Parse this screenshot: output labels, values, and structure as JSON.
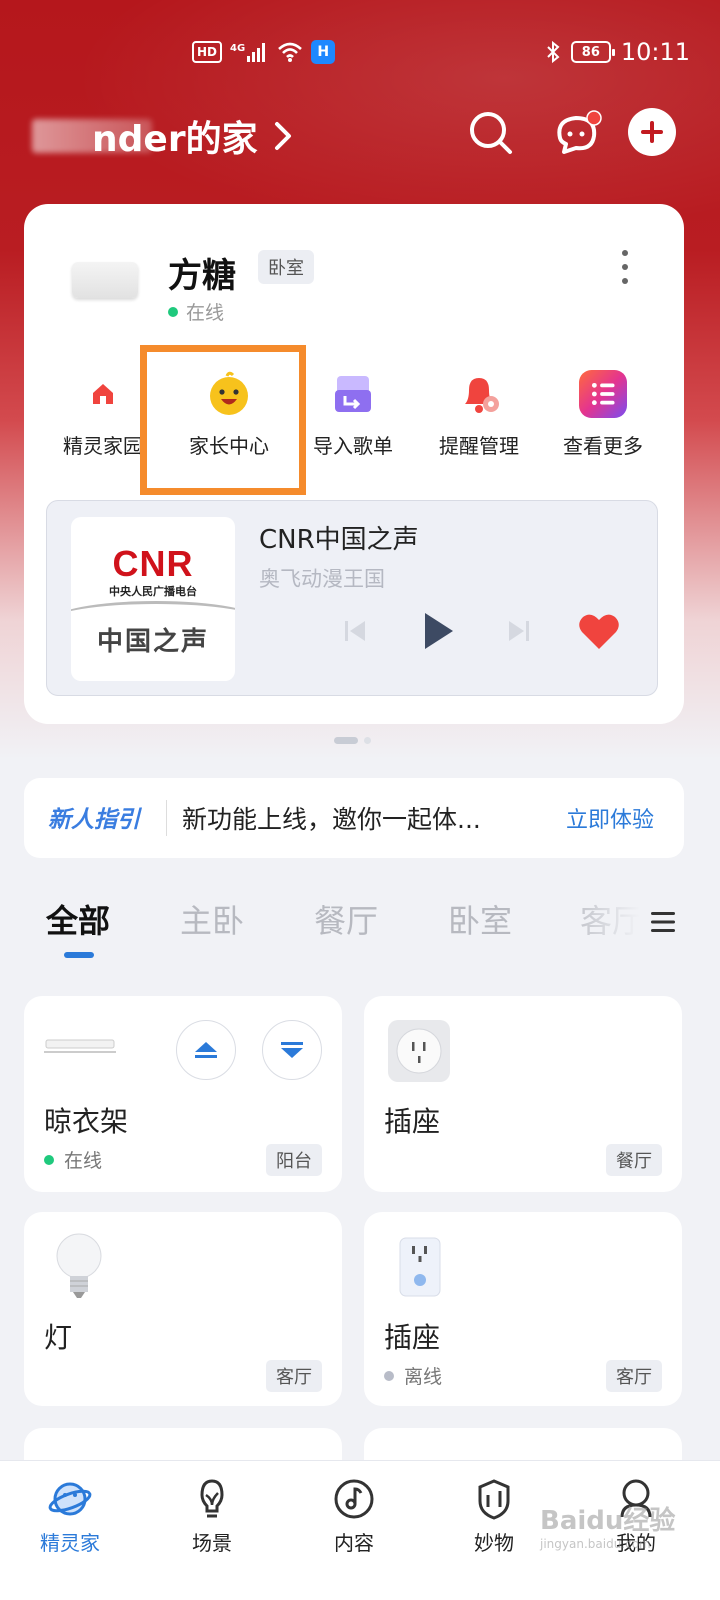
{
  "status_bar": {
    "hd": "HD",
    "network": "4G",
    "battery": "86",
    "time": "10:11"
  },
  "header": {
    "home_title": "nder的家"
  },
  "device_card": {
    "device_name": "方糖",
    "room": "卧室",
    "status": "在线",
    "shortcuts": [
      {
        "label": "精灵家园",
        "icon": "house-icon"
      },
      {
        "label": "家长中心",
        "icon": "kid-face-icon"
      },
      {
        "label": "导入歌单",
        "icon": "import-playlist-icon"
      },
      {
        "label": "提醒管理",
        "icon": "bell-icon"
      },
      {
        "label": "查看更多",
        "icon": "list-more-icon"
      }
    ],
    "player": {
      "cover_brand": "CNR",
      "cover_subtitle": "中央人民广播电台",
      "cover_lower": "中国之声",
      "title": "CNR中国之声",
      "subtitle": "奥飞动漫王国"
    }
  },
  "banner": {
    "tag": "新人指引",
    "message": "新功能上线，邀你一起体...",
    "cta": "立即体验"
  },
  "room_tabs": [
    "全部",
    "主卧",
    "餐厅",
    "卧室",
    "客厅"
  ],
  "device_tiles": [
    {
      "name": "晾衣架",
      "status": "在线",
      "room": "阳台",
      "icon": "clothes-rack-icon"
    },
    {
      "name": "插座",
      "status": "",
      "room": "餐厅",
      "icon": "socket-icon"
    },
    {
      "name": "灯",
      "status": "",
      "room": "客厅",
      "icon": "bulb-icon"
    },
    {
      "name": "插座",
      "status": "离线",
      "room": "客厅",
      "icon": "wall-socket-icon"
    }
  ],
  "bottom_nav": [
    {
      "label": "精灵家",
      "icon": "planet-icon",
      "active": true
    },
    {
      "label": "场景",
      "icon": "scene-bulb-icon",
      "active": false
    },
    {
      "label": "内容",
      "icon": "music-note-icon",
      "active": false
    },
    {
      "label": "妙物",
      "icon": "shield-bag-icon",
      "active": false
    },
    {
      "label": "我的",
      "icon": "profile-icon",
      "active": false
    }
  ],
  "watermark": {
    "text": "Baidu经验",
    "url_text": "jingyan.baidu.com"
  },
  "colors": {
    "hero_red": "#b5171c",
    "accent_blue": "#2b7ad9",
    "highlight_orange": "#f58b2c",
    "online_green": "#1fc97d",
    "heart_red": "#f0443e"
  }
}
